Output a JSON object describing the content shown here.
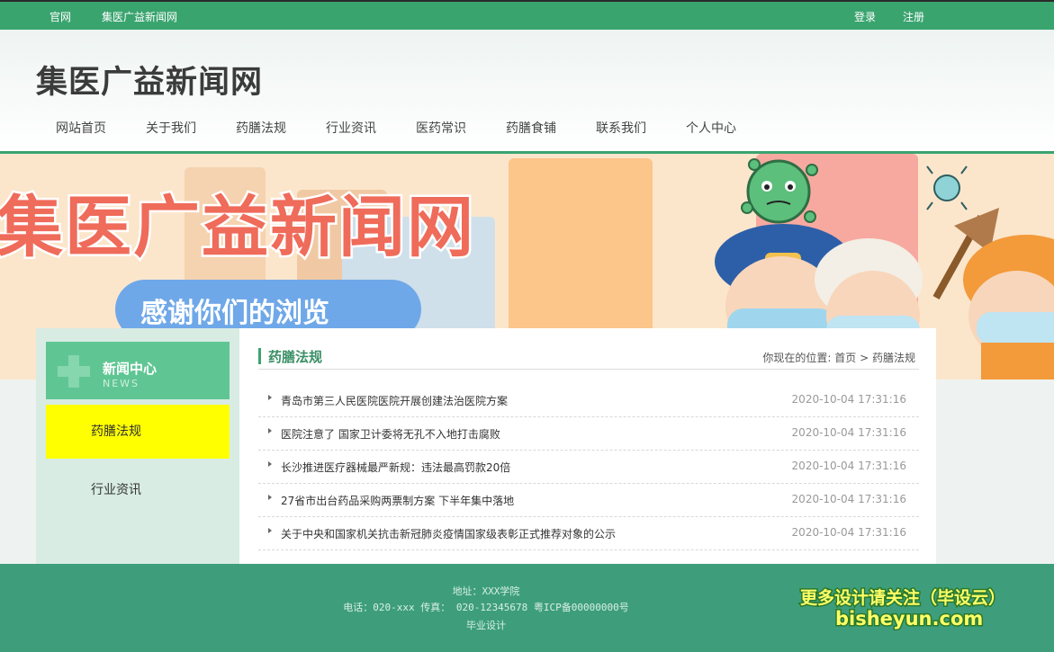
{
  "topbar": {
    "left_links": [
      "官网",
      "集医广益新闻网"
    ],
    "right_links": [
      "登录",
      "注册"
    ]
  },
  "header": {
    "site_title": "集医广益新闻网",
    "nav": [
      "网站首页",
      "关于我们",
      "药膳法规",
      "行业资讯",
      "医药常识",
      "药膳食铺",
      "联系我们",
      "个人中心"
    ]
  },
  "banner": {
    "title": "集医广益新闻网",
    "subtitle": "感谢你们的浏览"
  },
  "sidebar": {
    "heading": "新闻中心",
    "heading_en": "NEWS",
    "items": [
      "药膳法规",
      "行业资讯"
    ],
    "active_item": "药膳法规"
  },
  "content": {
    "section_title": "药膳法规",
    "breadcrumb": {
      "prefix": "你现在的位置:",
      "home": "首页",
      "separator": ">",
      "current": "药膳法规"
    },
    "articles": [
      {
        "title": "青岛市第三人民医院医院开展创建法治医院方案",
        "date": "2020-10-04 17:31:16"
      },
      {
        "title": "医院注意了 国家卫计委将无孔不入地打击腐败",
        "date": "2020-10-04 17:31:16"
      },
      {
        "title": "长沙推进医疗器械最严新规：违法最高罚款20倍",
        "date": "2020-10-04 17:31:16"
      },
      {
        "title": "27省市出台药品采购两票制方案 下半年集中落地",
        "date": "2020-10-04 17:31:16"
      },
      {
        "title": "关于中央和国家机关抗击新冠肺炎疫情国家级表彰正式推荐对象的公示",
        "date": "2020-10-04 17:31:16"
      }
    ]
  },
  "footer": {
    "address": "地址：XXX学院",
    "contact": "电话：020-xxx 传真： 020-12345678 粤ICP备00000000号",
    "note": "毕业设计",
    "promo_line1": "更多设计请关注（毕设云）",
    "promo_line2": "bisheyun.com"
  },
  "colors": {
    "primary_green": "#3aa46f",
    "sidebar_head": "#5fc693",
    "active_highlight": "#ffff00",
    "footer_bg": "#3e9e7c",
    "banner_title": "#ef6b5a"
  }
}
